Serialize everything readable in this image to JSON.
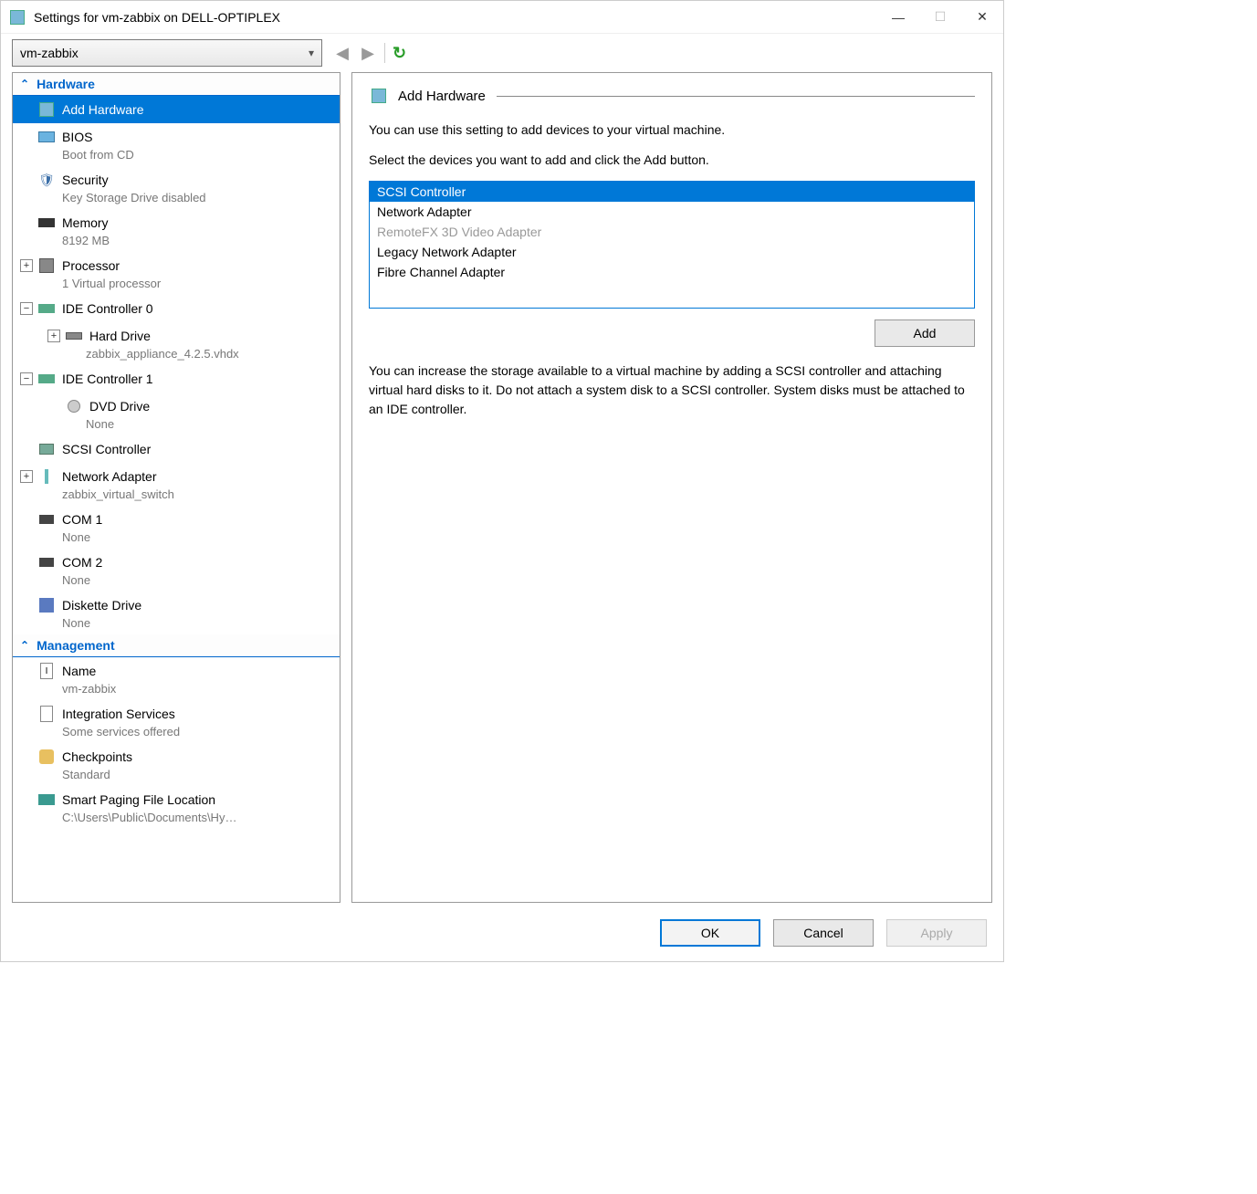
{
  "window": {
    "title": "Settings for vm-zabbix on DELL-OPTIPLEX"
  },
  "toolbar": {
    "vm_name": "vm-zabbix"
  },
  "sidebar": {
    "sections": {
      "hardware": "Hardware",
      "management": "Management"
    },
    "items": [
      {
        "label": "Add Hardware"
      },
      {
        "label": "BIOS",
        "sub": "Boot from CD"
      },
      {
        "label": "Security",
        "sub": "Key Storage Drive disabled"
      },
      {
        "label": "Memory",
        "sub": "8192 MB"
      },
      {
        "label": "Processor",
        "sub": "1 Virtual processor"
      },
      {
        "label": "IDE Controller 0"
      },
      {
        "label": "Hard Drive",
        "sub": "zabbix_appliance_4.2.5.vhdx"
      },
      {
        "label": "IDE Controller 1"
      },
      {
        "label": "DVD Drive",
        "sub": "None"
      },
      {
        "label": "SCSI Controller"
      },
      {
        "label": "Network Adapter",
        "sub": "zabbix_virtual_switch"
      },
      {
        "label": "COM 1",
        "sub": "None"
      },
      {
        "label": "COM 2",
        "sub": "None"
      },
      {
        "label": "Diskette Drive",
        "sub": "None"
      },
      {
        "label": "Name",
        "sub": "vm-zabbix"
      },
      {
        "label": "Integration Services",
        "sub": "Some services offered"
      },
      {
        "label": "Checkpoints",
        "sub": "Standard"
      },
      {
        "label": "Smart Paging File Location",
        "sub": "C:\\Users\\Public\\Documents\\Hy…"
      }
    ]
  },
  "panel": {
    "title": "Add Hardware",
    "desc1": "You can use this setting to add devices to your virtual machine.",
    "desc2": "Select the devices you want to add and click the Add button.",
    "devices": [
      "SCSI Controller",
      "Network Adapter",
      "RemoteFX 3D Video Adapter",
      "Legacy Network Adapter",
      "Fibre Channel Adapter"
    ],
    "add_label": "Add",
    "help": "You can increase the storage available to a virtual machine by adding a SCSI controller and attaching virtual hard disks to it. Do not attach a system disk to a SCSI controller. System disks must be attached to an IDE controller."
  },
  "footer": {
    "ok": "OK",
    "cancel": "Cancel",
    "apply": "Apply"
  }
}
